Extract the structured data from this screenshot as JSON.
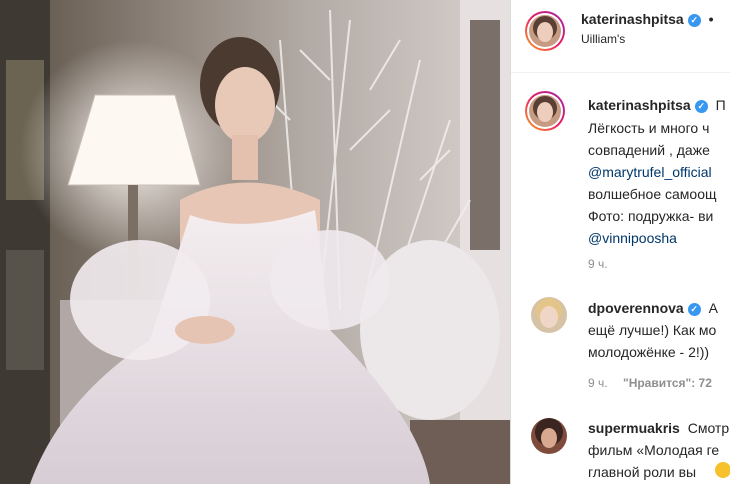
{
  "post": {
    "author": "katerinashpitsa",
    "header_dot": "•",
    "location": "Uilliam's",
    "verified_glyph": "✓"
  },
  "caption": {
    "author": "katerinashpitsa",
    "lines": [
      "П",
      "Лёгкость и много ч",
      "совпадений , даже",
      "@marytrufel_official",
      "волшебное самоощ",
      "Фото: подружка- ви",
      "@vinnipoosha"
    ],
    "time": "9 ч."
  },
  "comments": [
    {
      "author": "dpoverennova",
      "verified": true,
      "lines": [
        "А",
        "ещё лучше!) Как мо",
        "молодожёнке - 2!))"
      ],
      "time": "9 ч.",
      "likes": "\"Нравится\": 72"
    },
    {
      "author": "supermuakris",
      "verified": false,
      "lines": [
        "Смотр",
        "фильм «Молодая ге",
        "главной роли вы"
      ]
    }
  ],
  "colors": {
    "text": "#262626",
    "mention": "#00376b",
    "meta": "#8e8e8e",
    "verified": "#3897f0"
  }
}
